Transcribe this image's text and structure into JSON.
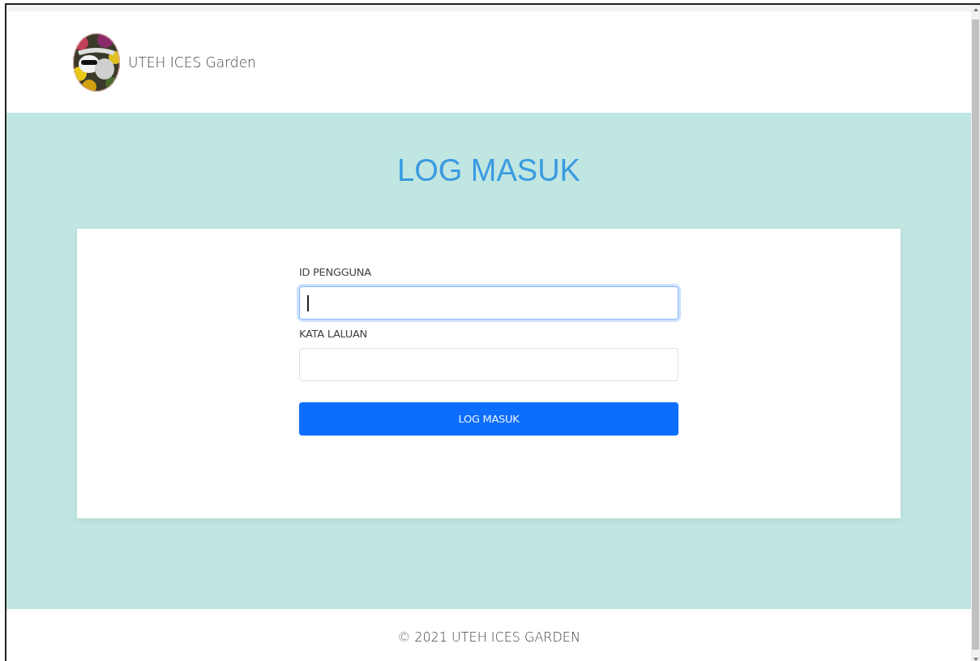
{
  "header": {
    "brand": "UTEH ICES Garden"
  },
  "login": {
    "title": "LOG MASUK",
    "fields": [
      {
        "label": "ID PENGGUNA",
        "focused": true
      },
      {
        "label": "KATA LALUAN",
        "focused": false
      }
    ],
    "button": "LOG MASUK"
  },
  "footer": "© 2021 UTEH ICES GARDEN"
}
